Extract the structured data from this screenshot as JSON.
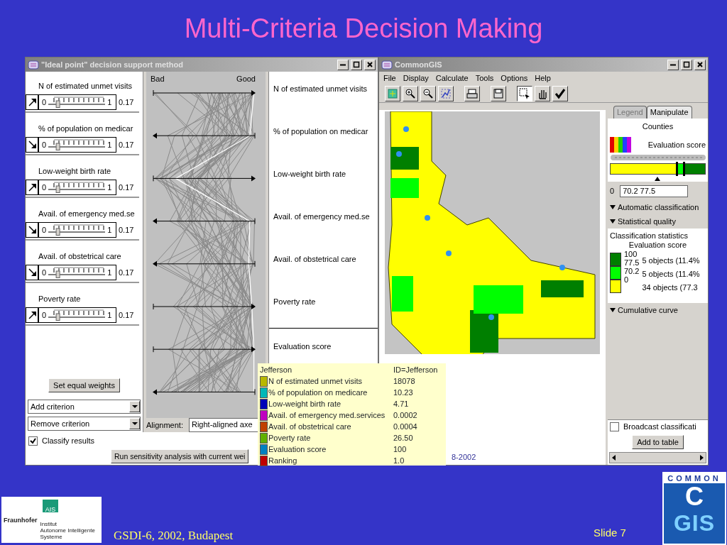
{
  "slide": {
    "title": "Multi-Criteria Decision Making",
    "footer": "GSDI-6, 2002, Budapest",
    "slide_number": "Slide 7"
  },
  "institute_logo": {
    "badge": "AIS",
    "name": "Fraunhofer",
    "lines": [
      "Institut",
      "Autonome Intelligente",
      "Systeme"
    ]
  },
  "product_logo": {
    "top": "COMMON",
    "letter": "C",
    "bottom": "GIS"
  },
  "ideal_point_window": {
    "title": "\"Ideal point\" decision support method",
    "criteria": [
      {
        "name": "N of estimated unmet visits",
        "kind": "up",
        "min": "0",
        "max": "1",
        "weight": "0.17",
        "level": 0.17
      },
      {
        "name": "% of population on medicar",
        "kind": "down",
        "min": "0",
        "max": "1",
        "weight": "0.17",
        "level": 0.17
      },
      {
        "name": "Low-weight birth rate",
        "kind": "up",
        "min": "0",
        "max": "1",
        "weight": "0.17",
        "level": 0.17
      },
      {
        "name": "Avail. of emergency med.se",
        "kind": "down",
        "min": "0",
        "max": "1",
        "weight": "0.17",
        "level": 0.17
      },
      {
        "name": "Avail. of obstetrical care",
        "kind": "down",
        "min": "0",
        "max": "1",
        "weight": "0.17",
        "level": 0.17
      },
      {
        "name": "Poverty rate",
        "kind": "up",
        "min": "0",
        "max": "1",
        "weight": "0.17",
        "level": 0.17
      }
    ],
    "scale_low": "Bad",
    "scale_high": "Good",
    "axis_names": [
      "N of estimated unmet visits",
      "% of population on medicar",
      "Low-weight birth rate",
      "Avail. of emergency med.se",
      "Avail. of obstetrical care",
      "Poverty rate",
      "Evaluation score"
    ],
    "equal_weights_button": "Set equal weights",
    "add_dropdown": "Add criterion",
    "remove_dropdown": "Remove criterion",
    "alignment_label": "Alignment:",
    "alignment_value": "Right-aligned axe",
    "classify": {
      "label": "Classify results",
      "checked": true
    },
    "run_button": "Run sensitivity analysis with current wei"
  },
  "gis_window": {
    "title": "CommonGIS",
    "menu": [
      "File",
      "Display",
      "Calculate",
      "Tools",
      "Options",
      "Help"
    ],
    "toolbar": [
      {
        "kind": "extent",
        "selected": false
      },
      {
        "kind": "zoom-in",
        "selected": false
      },
      {
        "kind": "zoom-out",
        "selected": false
      },
      {
        "kind": "zoom-fit",
        "selected": false
      },
      {
        "kind": "print",
        "selected": false
      },
      {
        "kind": "save",
        "selected": false
      },
      {
        "kind": "select",
        "selected": true
      },
      {
        "kind": "pan",
        "selected": false
      },
      {
        "kind": "check",
        "selected": false
      }
    ],
    "status": "8-2002",
    "tabs": [
      {
        "label": "Legend",
        "selected": false
      },
      {
        "label": "Manipulate",
        "selected": true
      }
    ],
    "layer": "Counties",
    "attribute": "Evaluation score",
    "thumbs": [
      {
        "level": 0.702
      },
      {
        "level": 0.775
      }
    ],
    "breaks_label": "0",
    "breaks_value": "70.2 77.5",
    "sections": [
      {
        "label": "Automatic classification",
        "expanded": true
      },
      {
        "label": "Statistical quality",
        "expanded": true
      }
    ],
    "stats_title": "Classification statistics",
    "stats_attribute": "Evaluation score",
    "scale": [
      "100",
      "77.5",
      "70.2",
      "0"
    ],
    "classes": [
      {
        "color": "#007f00",
        "count": "5 objects (11.4%"
      },
      {
        "color": "#00ff00",
        "count": "5 objects (11.4%"
      },
      {
        "color": "#ffff00",
        "count": "34 objects (77.3"
      }
    ],
    "curve_section": {
      "label": "Cumulative curve",
      "expanded": true
    },
    "broadcast": {
      "label": "Broadcast classificati",
      "checked": false
    },
    "add_button": "Add to table"
  },
  "tooltip": {
    "title": "Jefferson",
    "id": "ID=Jefferson",
    "rows": [
      {
        "name": "N of estimated unmet visits",
        "value": "18078",
        "color": "#b8b800"
      },
      {
        "name": "% of population on medicare",
        "value": "10.23",
        "color": "#00b8b8"
      },
      {
        "name": "Low-weight birth rate",
        "value": "4.71",
        "color": "#0000b8"
      },
      {
        "name": "Avail. of emergency med.services",
        "value": "0.0002",
        "color": "#c000c0"
      },
      {
        "name": "Avail. of obstetrical care",
        "value": "0.0004",
        "color": "#c04000"
      },
      {
        "name": "Poverty rate",
        "value": "26.50",
        "color": "#60b000"
      },
      {
        "name": "Evaluation score",
        "value": "100",
        "color": "#0080c0"
      },
      {
        "name": "Ranking",
        "value": "1.0",
        "color": "#c00000"
      }
    ]
  }
}
